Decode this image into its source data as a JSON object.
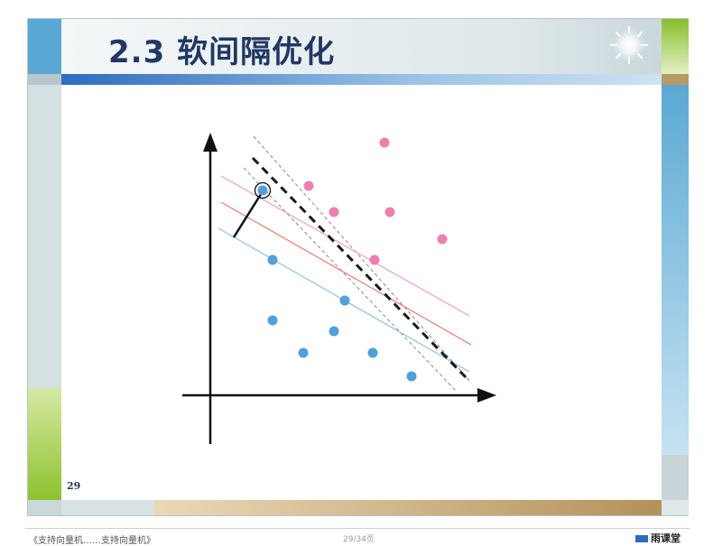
{
  "slide": {
    "title": "2.3 软间隔优化",
    "page_number": "29"
  },
  "footer": {
    "left_text": "《支持向量机……支持向量机》",
    "page_indicator": "29/34页",
    "brand": "雨课堂"
  },
  "colors": {
    "title": "#1f3864",
    "positive_class": "#ee7fae",
    "negative_class": "#4fa0dc",
    "upper_margin": "#f2a0b4",
    "lower_margin": "#8ec3ea",
    "middle_line": "#f07a6a",
    "decision_boundary": "#1a1a1a"
  }
}
